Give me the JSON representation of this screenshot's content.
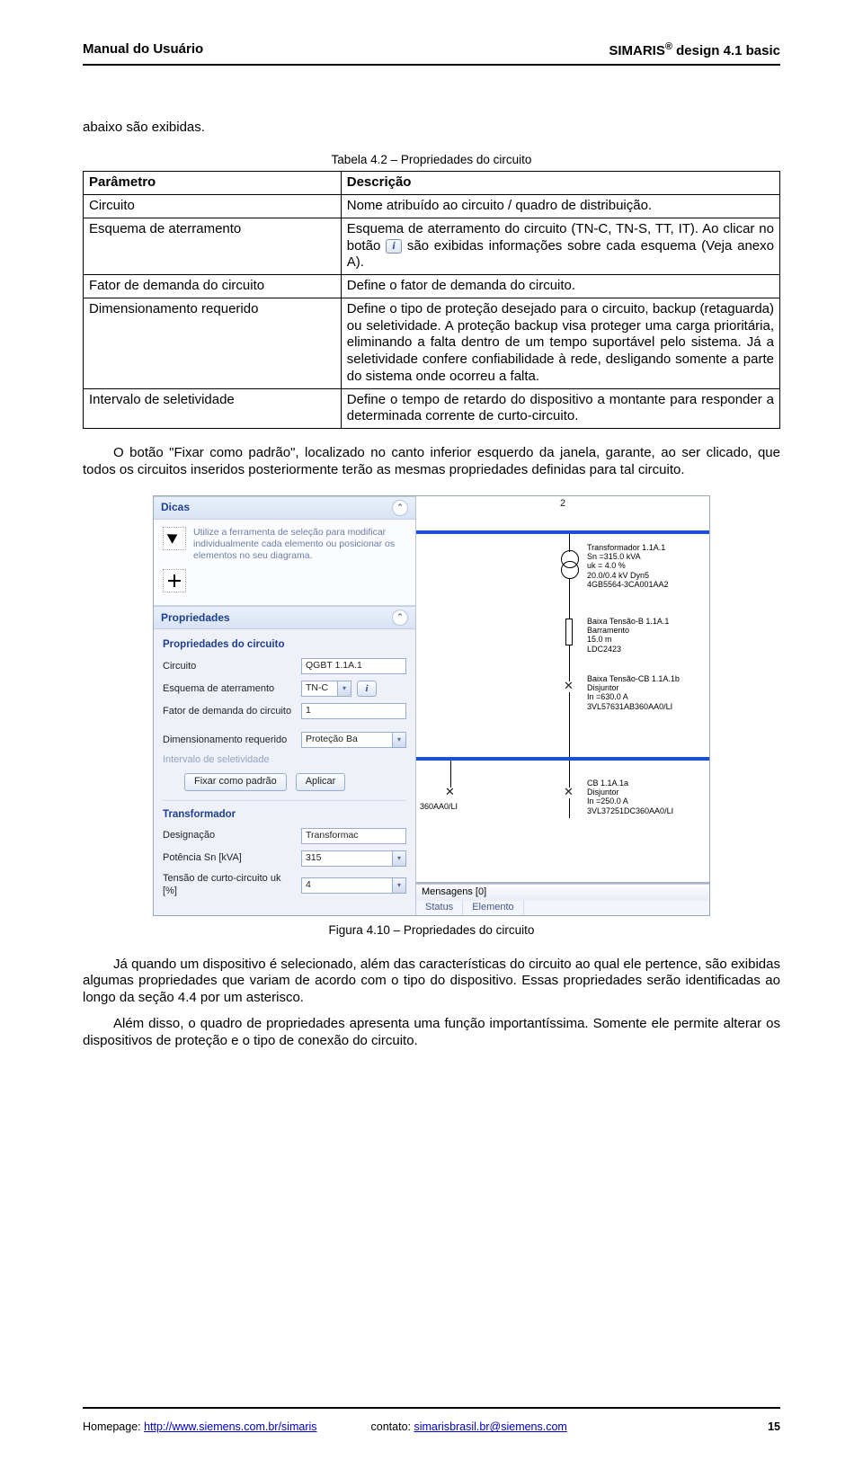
{
  "header": {
    "left": "Manual do Usuário",
    "right_product": "SIMARIS",
    "right_reg": "®",
    "right_suffix": " design 4.1 basic"
  },
  "intro_line": "abaixo são exibidas.",
  "table_caption": "Tabela 4.2 – Propriedades do circuito",
  "table": {
    "head_param": "Parâmetro",
    "head_desc": "Descrição",
    "rows": [
      {
        "param": "Circuito",
        "desc": "Nome atribuído ao circuito / quadro de distribuição."
      },
      {
        "param": "Esquema de aterramento",
        "desc_pre": "Esquema de aterramento do circuito (TN-C, TN-S, TT, IT). Ao clicar no botão ",
        "desc_post": " são exibidas informações sobre cada esquema (Veja anexo A)."
      },
      {
        "param": "Fator de demanda do circuito",
        "desc": "Define o fator de demanda do circuito."
      },
      {
        "param": "Dimensionamento requerido",
        "desc": "Define o tipo de proteção desejado para o circuito, backup (retaguarda) ou seletividade. A proteção backup visa proteger uma carga prioritária, eliminando a falta dentro de um tempo suportável pelo sistema. Já a seletividade confere confiabilidade à rede, desligando somente a parte do sistema onde ocorreu a falta."
      },
      {
        "param": "Intervalo de seletividade",
        "desc": "Define o tempo de retardo do dispositivo a montante para responder a determinada corrente de curto-circuito."
      }
    ]
  },
  "para1": "O botão \"Fixar como padrão\", localizado no canto inferior esquerdo da janela, garante, ao ser clicado, que todos os circuitos inseridos posteriormente terão as mesmas propriedades definidas para tal circuito.",
  "panel": {
    "dicas_title": "Dicas",
    "dicas_tip1": "Utilize a ferramenta de seleção para modificar individualmente cada elemento ou posicionar os elementos no seu diagrama.",
    "dicas_tip2": "",
    "props_title": "Propriedades",
    "props_sub": "Propriedades do circuito",
    "fields": {
      "circuito_label": "Circuito",
      "circuito_value": "QGBT 1.1A.1",
      "esquema_label": "Esquema de aterramento",
      "esquema_value": "TN-C",
      "fator_label": "Fator de demanda do circuito",
      "fator_value": "1",
      "dim_label": "Dimensionamento requerido",
      "dim_value": "Proteção Ba",
      "interv_label": "Intervalo de seletividade"
    },
    "btn_fixar": "Fixar como padrão",
    "btn_aplicar": "Aplicar",
    "transf_sub": "Transformador",
    "transf_fields": {
      "designacao_label": "Designação",
      "designacao_value": "Transformac",
      "potencia_label": "Potência Sn [kVA]",
      "potencia_value": "315",
      "tensao_label": "Tensão de curto-circuito uk [%]",
      "tensao_value": "4"
    },
    "diagram": {
      "top_col": "2",
      "transf_text": "Transformador 1.1A.1\nSn =315.0 kVA\nuk = 4.0 %\n20.0/0.4 kV Dyn5\n4GB5564-3CA001AA2",
      "bar_text": "Baixa Tensão-B 1.1A.1\nBarramento\n15.0 m\nLDC2423",
      "cb1_text": "Baixa Tensão-CB 1.1A.1b\nDisjuntor\nIn =630.0 A\n3VL57631AB360AA0/LI",
      "cb_left": "360AA0/LI",
      "cb2_text": "CB 1.1A.1a\nDisjuntor\nIn =250.0 A\n3VL37251DC360AA0/LI"
    },
    "messages": {
      "header": "Mensagens [0]",
      "col_status": "Status",
      "col_elem": "Elemento"
    }
  },
  "figure_caption": "Figura 4.10 – Propriedades do circuito",
  "para2": "Já quando um dispositivo é selecionado, além das características do circuito ao qual ele pertence, são exibidas algumas propriedades que variam de acordo com o tipo do dispositivo. Essas propriedades serão identificadas ao longo da seção 4.4 por um asterisco.",
  "para3": "Além disso, o quadro de propriedades apresenta uma função importantíssima. Somente ele permite alterar os dispositivos de proteção e o tipo de conexão do circuito.",
  "footer": {
    "homepage_label": "Homepage: ",
    "homepage_url": "http://www.siemens.com.br/simaris",
    "contact_label": "contato: ",
    "contact_email": "simarisbrasil.br@siemens.com",
    "page": "15"
  }
}
